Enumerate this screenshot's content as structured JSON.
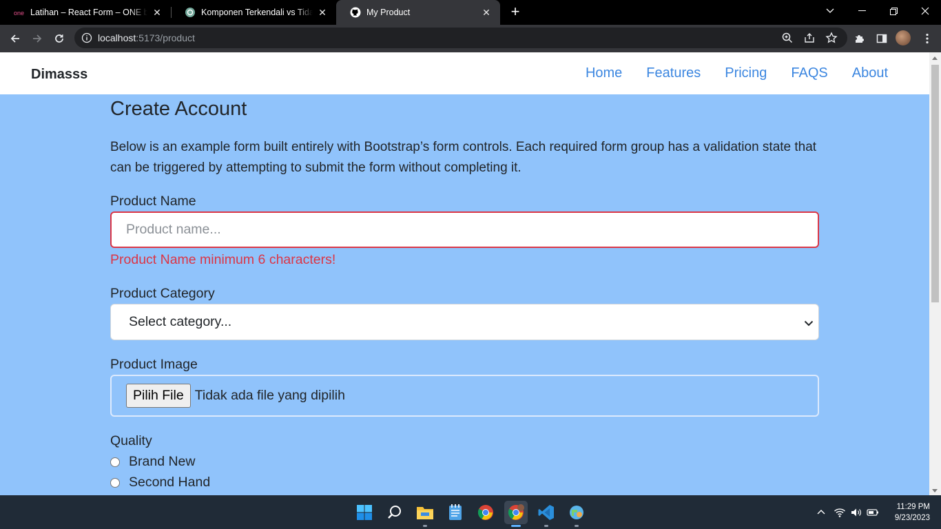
{
  "browser": {
    "tabs": [
      {
        "title": "Latihan – React Form – ONE by Alterra",
        "favicon": "alterra-one-icon"
      },
      {
        "title": "Komponen Terkendali vs Tidak Terkendali",
        "favicon": "chatgpt-icon"
      },
      {
        "title": "My Product",
        "favicon": "github-icon",
        "active": true
      }
    ],
    "url_host": "localhost",
    "url_rest": ":5173/product"
  },
  "navbar": {
    "brand": "Dimasss",
    "links": [
      "Home",
      "Features",
      "Pricing",
      "FAQS",
      "About"
    ]
  },
  "form": {
    "title": "Create Account",
    "description": "Below is an example form built entirely with Bootstrap’s form controls. Each required form group has a validation state that can be triggered by attempting to submit the form without completing it.",
    "product_name": {
      "label": "Product Name",
      "placeholder": "Product name...",
      "error": "Product Name minimum 6 characters!"
    },
    "product_category": {
      "label": "Product Category",
      "selected": "Select category..."
    },
    "product_image": {
      "label": "Product Image",
      "button": "Pilih File",
      "status": "Tidak ada file yang dipilih"
    },
    "quality": {
      "label": "Quality",
      "options": [
        "Brand New",
        "Second Hand"
      ]
    }
  },
  "taskbar": {
    "time": "11:29 PM",
    "date": "9/23/2023"
  },
  "colors": {
    "page_bg": "#90c3fb",
    "nav_link": "#3b86e0",
    "error": "#dc3545"
  }
}
